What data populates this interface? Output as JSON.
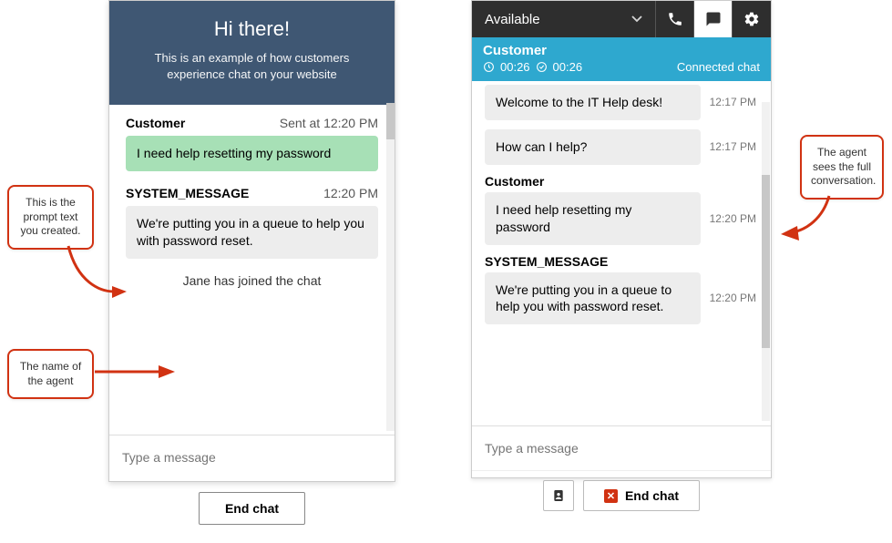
{
  "customer_chat": {
    "header_title": "Hi there!",
    "header_sub": "This is an example of how customers experience chat on your website",
    "messages": [
      {
        "sender": "Customer",
        "time_prefix": "Sent at",
        "time": "12:20 PM",
        "text": "I need help resetting my password",
        "style": "green"
      },
      {
        "sender": "SYSTEM_MESSAGE",
        "time_prefix": "",
        "time": "12:20 PM",
        "text": "We're putting you in a queue to help you with password reset.",
        "style": "grey"
      }
    ],
    "joined_text": "Jane has joined the chat",
    "input_placeholder": "Type a message",
    "end_chat_label": "End chat"
  },
  "agent_panel": {
    "status": "Available",
    "contact_name": "Customer",
    "timer1": "00:26",
    "timer2": "00:26",
    "conn_status": "Connected chat",
    "messages": [
      {
        "sender": "",
        "text": "Welcome to the IT Help desk!",
        "time": "12:17 PM"
      },
      {
        "sender": "",
        "text": "How can I help?",
        "time": "12:17 PM"
      },
      {
        "sender": "Customer",
        "text": "I need help resetting my password",
        "time": "12:20 PM"
      },
      {
        "sender": "SYSTEM_MESSAGE",
        "text": "We're putting you in a queue to help you with password reset.",
        "time": "12:20 PM"
      }
    ],
    "input_placeholder": "Type a message",
    "end_chat_label": "End chat"
  },
  "callouts": {
    "c1": "This is the prompt text you created.",
    "c2": "The name of the agent",
    "c3": "The agent sees the full conversation."
  }
}
